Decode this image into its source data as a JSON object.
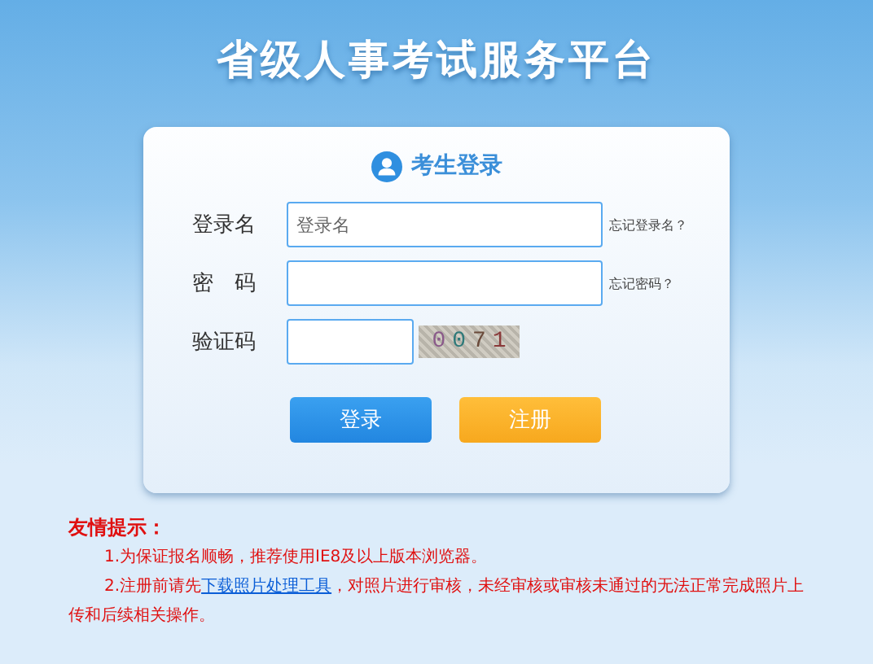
{
  "header": {
    "title": "省级人事考试服务平台"
  },
  "login": {
    "title": "考生登录",
    "fields": [
      {
        "kind": "text",
        "label": "登录名",
        "placeholder": "登录名",
        "help": "忘记登录名？"
      },
      {
        "kind": "password",
        "label": "密　码",
        "help": "忘记密码？"
      },
      {
        "kind": "captcha",
        "label": "验证码",
        "captcha": "0071"
      }
    ],
    "buttons": [
      {
        "kind": "primary",
        "label": "登录"
      },
      {
        "kind": "secondary",
        "label": "注册"
      }
    ]
  },
  "notice": {
    "title": "友情提示：",
    "items": [
      {
        "before": "1.为保证报名顺畅，推荐使用IE8及以上版本浏览器。"
      },
      {
        "before": "2.注册前请先",
        "link": "下载照片处理工具",
        "after": "，对照片进行审核，未经审核或审核未通过的无法正常完成照片上传和后续相关操作。"
      }
    ]
  }
}
